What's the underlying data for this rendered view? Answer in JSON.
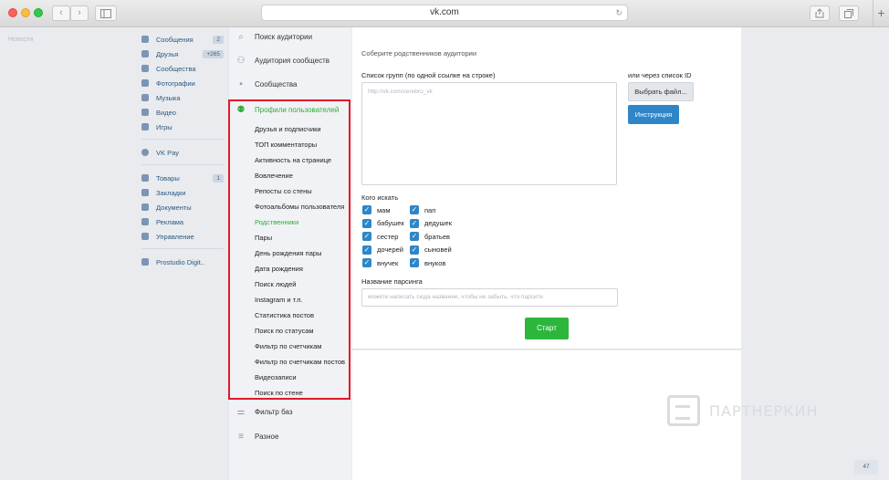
{
  "browser": {
    "url": "vk.com",
    "back_glyph": "‹",
    "forward_glyph": "›",
    "reload_glyph": "↻",
    "new_tab_glyph": "+"
  },
  "ghost_text": "Новости",
  "left_menu": {
    "items": [
      {
        "label": "Сообщения",
        "count": "2",
        "icon": "message-icon"
      },
      {
        "label": "Друзья",
        "count": "+265",
        "icon": "friends-icon"
      },
      {
        "label": "Сообщества",
        "count": "",
        "icon": "communities-icon"
      },
      {
        "label": "Фотографии",
        "count": "",
        "icon": "photos-icon"
      },
      {
        "label": "Музыка",
        "count": "",
        "icon": "music-icon"
      },
      {
        "label": "Видео",
        "count": "",
        "icon": "video-icon"
      },
      {
        "label": "Игры",
        "count": "",
        "icon": "games-icon"
      }
    ],
    "vkpay": {
      "label": "VK Pay",
      "icon": "vkpay-icon"
    },
    "items2": [
      {
        "label": "Товары",
        "count": "1",
        "icon": "goods-icon"
      },
      {
        "label": "Закладки",
        "count": "",
        "icon": "bookmarks-icon"
      },
      {
        "label": "Документы",
        "count": "",
        "icon": "documents-icon"
      },
      {
        "label": "Реклама",
        "count": "",
        "icon": "ads-icon"
      },
      {
        "label": "Управление",
        "count": "",
        "icon": "manage-icon"
      }
    ],
    "app": {
      "label": "Prostudio Digit..",
      "icon": "app-icon"
    }
  },
  "tool_sidebar": {
    "top_items": [
      {
        "label": "Поиск аудитории",
        "icon": "search-icon"
      },
      {
        "label": "Аудитория сообществ",
        "icon": "audience-icon"
      },
      {
        "label": "Сообщества",
        "icon": "chat-icon"
      }
    ],
    "section_header": {
      "label": "Профили пользователей",
      "icon": "user-profile-icon"
    },
    "sub_items": [
      "Друзья и подписчики",
      "ТОП комментаторы",
      "Активность на странице",
      "Вовлечение",
      "Репосты со стены",
      "Фотоальбомы пользователя",
      "Родственники",
      "Пары",
      "День рождения пары",
      "Дата рождения",
      "Поиск людей",
      "Instagram и т.п.",
      "Статистика постов",
      "Поиск по статусам",
      "Фильтр по счетчикам",
      "Фильтр по счетчикам постов",
      "Видеозаписи",
      "Поиск по стене"
    ],
    "active_sub_item": "Родственники",
    "bottom_items": [
      {
        "label": "Фильтр баз",
        "icon": "filter-icon"
      },
      {
        "label": "Разное",
        "icon": "menu-icon"
      }
    ]
  },
  "main": {
    "title": "Соберите родственников аудитории",
    "groups_label": "Список групп (по одной ссылке на строке)",
    "groups_placeholder": "http://vk.com/cerebro_vk",
    "id_list_label": "или через список ID",
    "choose_file_button": "Выбрать файл...",
    "instruction_button": "Инструкция",
    "who_label": "Кого искать",
    "checkboxes_left": [
      {
        "label": "мам",
        "checked": true
      },
      {
        "label": "бабушек",
        "checked": true
      },
      {
        "label": "сестер",
        "checked": true
      },
      {
        "label": "дочерей",
        "checked": true
      },
      {
        "label": "внучек",
        "checked": true
      }
    ],
    "checkboxes_right": [
      {
        "label": "пап",
        "checked": true
      },
      {
        "label": "дедушек",
        "checked": true
      },
      {
        "label": "братьев",
        "checked": true
      },
      {
        "label": "сыновей",
        "checked": true
      },
      {
        "label": "внуков",
        "checked": true
      }
    ],
    "parsing_name_label": "Название парсинга",
    "parsing_name_placeholder": "можете написать сюда название, чтобы не забыть, что парсите",
    "start_button": "Старт"
  },
  "watermark": {
    "text": "ПАРТНЕРКИН"
  },
  "zoom_badge": "47",
  "colors": {
    "accent_green": "#2fae35",
    "accent_blue": "#2e86c8",
    "highlight_red": "#e2192a",
    "link_blue": "#2a5885"
  }
}
